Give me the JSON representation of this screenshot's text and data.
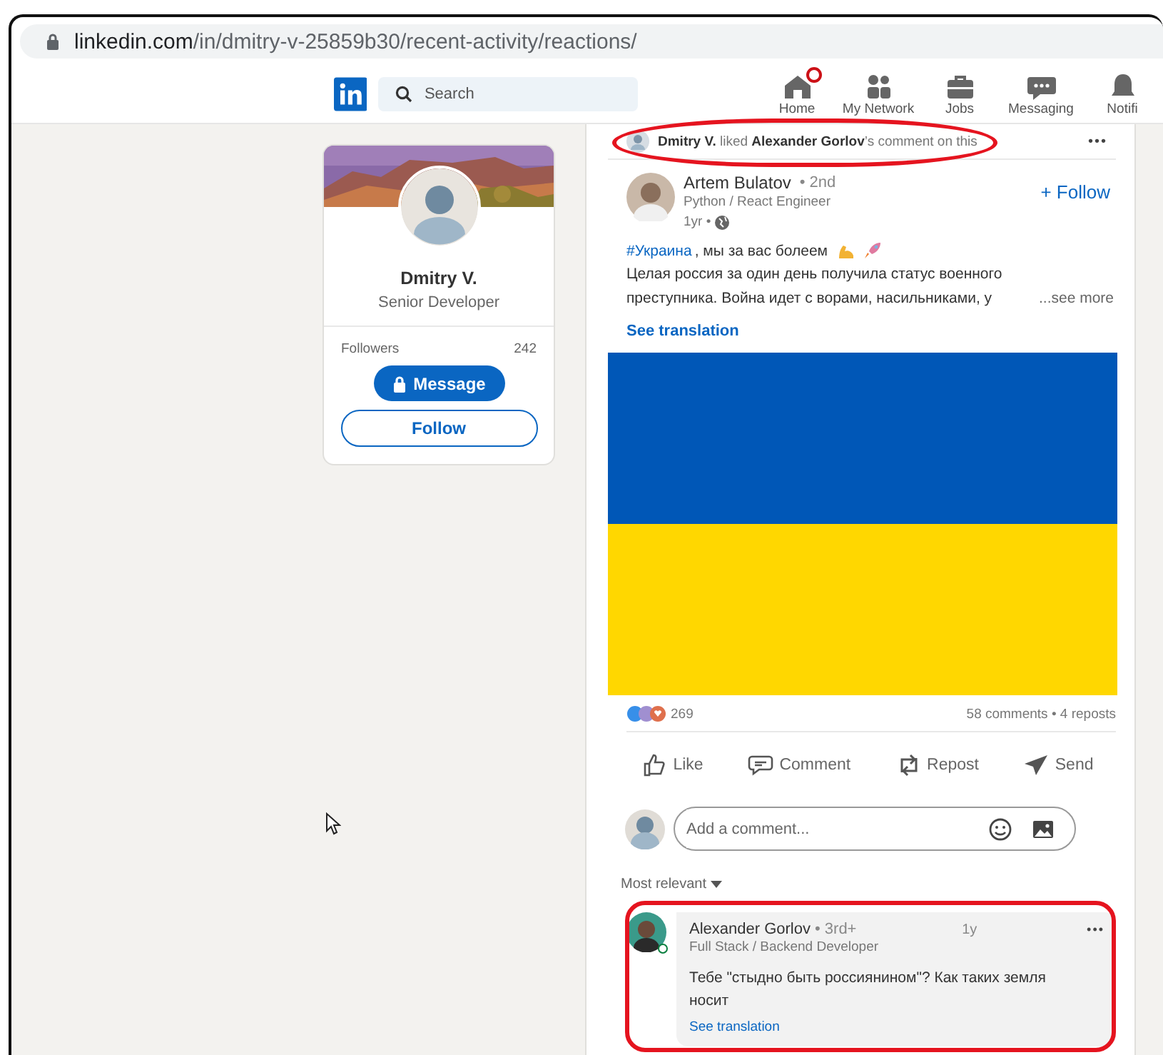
{
  "browser": {
    "url_host": "linkedin.com",
    "url_path": "/in/dmitry-v-25859b30/recent-activity/reactions/"
  },
  "nav": {
    "search": {
      "placeholder": "Search"
    },
    "items": [
      {
        "kind": "home",
        "label": "Home",
        "badge": true
      },
      {
        "kind": "network",
        "label": "My Network",
        "badge": false
      },
      {
        "kind": "jobs",
        "label": "Jobs",
        "badge": false
      },
      {
        "kind": "messaging",
        "label": "Messaging",
        "badge": false
      },
      {
        "kind": "notifications",
        "label": "Notifi",
        "badge": false
      }
    ]
  },
  "profile": {
    "name": "Dmitry V.",
    "headline": "Senior Developer",
    "followers_label": "Followers",
    "followers_count": "242",
    "buttons": [
      {
        "kind": "primary",
        "label": "Message",
        "locked": true
      },
      {
        "kind": "outline",
        "label": "Follow",
        "locked": false
      }
    ]
  },
  "activity": {
    "text": "**Dmitry V.** liked **Alexander Gorlov**’s comment on this",
    "menu": "•••"
  },
  "post": {
    "author": "Artem Bulatov",
    "degree": "• 2nd",
    "headline": "Python / React Engineer",
    "time": "1yr •",
    "follow": "+ Follow",
    "hashtag": "#Украина",
    "first_line": ", мы за вас болеем",
    "body": "Целая россия за один день получила статус военного преступника. Война идет с ворами, насильниками, у",
    "see_more": "...see more",
    "see_translation": "See translation",
    "reactions_count": "269",
    "stats": "58 comments • 4 reposts",
    "actions": [
      {
        "kind": "like",
        "label": "Like"
      },
      {
        "kind": "comment",
        "label": "Comment"
      },
      {
        "kind": "repost",
        "label": "Repost"
      },
      {
        "kind": "send",
        "label": "Send"
      }
    ],
    "comment_field": {
      "placeholder": "Add a comment..."
    },
    "sort": "Most relevant"
  },
  "comment": {
    "author": "Alexander Gorlov",
    "degree": "• 3rd+",
    "headline": "Full Stack / Backend Developer",
    "time": "1y",
    "menu": "•••",
    "online": true,
    "text": "Тебе \"стыдно быть россиянином\"? Как таких земля носит",
    "see_translation": "See translation"
  }
}
